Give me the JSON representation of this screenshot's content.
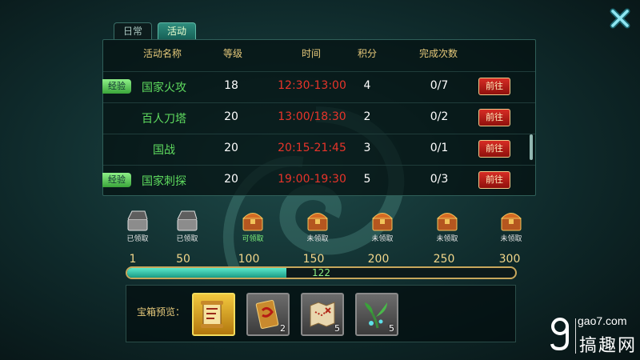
{
  "tabs": [
    {
      "label": "日常"
    },
    {
      "label": "活动"
    }
  ],
  "table": {
    "headers": {
      "name": "活动名称",
      "level": "等级",
      "time": "时间",
      "score": "积分",
      "done": "完成次数"
    },
    "rows": [
      {
        "tag": "经验",
        "name": "国家火攻",
        "level": "18",
        "time": "12:30-13:00",
        "score": "4",
        "done": "0/7",
        "button": "前往"
      },
      {
        "tag": "",
        "name": "百人刀塔",
        "level": "20",
        "time": "13:00/18:30",
        "score": "2",
        "done": "0/2",
        "button": "前往"
      },
      {
        "tag": "",
        "name": "国战",
        "level": "20",
        "time": "20:15-21:45",
        "score": "3",
        "done": "0/1",
        "button": "前往"
      },
      {
        "tag": "经验",
        "name": "国家刺探",
        "level": "20",
        "time": "19:00-19:30",
        "score": "5",
        "done": "0/3",
        "button": "前往"
      }
    ],
    "scroll_position": 0.62
  },
  "chests": [
    {
      "label": "已领取",
      "state": "claimed"
    },
    {
      "label": "已领取",
      "state": "claimed"
    },
    {
      "label": "可领取",
      "state": "ready"
    },
    {
      "label": "未领取",
      "state": "locked"
    },
    {
      "label": "未领取",
      "state": "locked"
    },
    {
      "label": "未领取",
      "state": "locked"
    },
    {
      "label": "未领取",
      "state": "locked"
    }
  ],
  "milestones": [
    "1",
    "50",
    "100",
    "150",
    "200",
    "250",
    "300"
  ],
  "progress": {
    "value": 122,
    "max": 300,
    "text": "122"
  },
  "preview": {
    "label": "宝箱预览：",
    "items": [
      {
        "icon": "scroll-icon",
        "count": ""
      },
      {
        "icon": "card-icon",
        "count": "2"
      },
      {
        "icon": "treasure-map-icon",
        "count": "5"
      },
      {
        "icon": "herb-icon",
        "count": "5"
      }
    ]
  },
  "watermark": {
    "url": "gao7.com",
    "name": "搞趣网"
  },
  "colors": {
    "activity_name": "#5fdc5f",
    "time": "#e8342a",
    "header": "#e6c97a",
    "go_button": "#c0201a",
    "progress_fill": "#3cc8a8"
  }
}
